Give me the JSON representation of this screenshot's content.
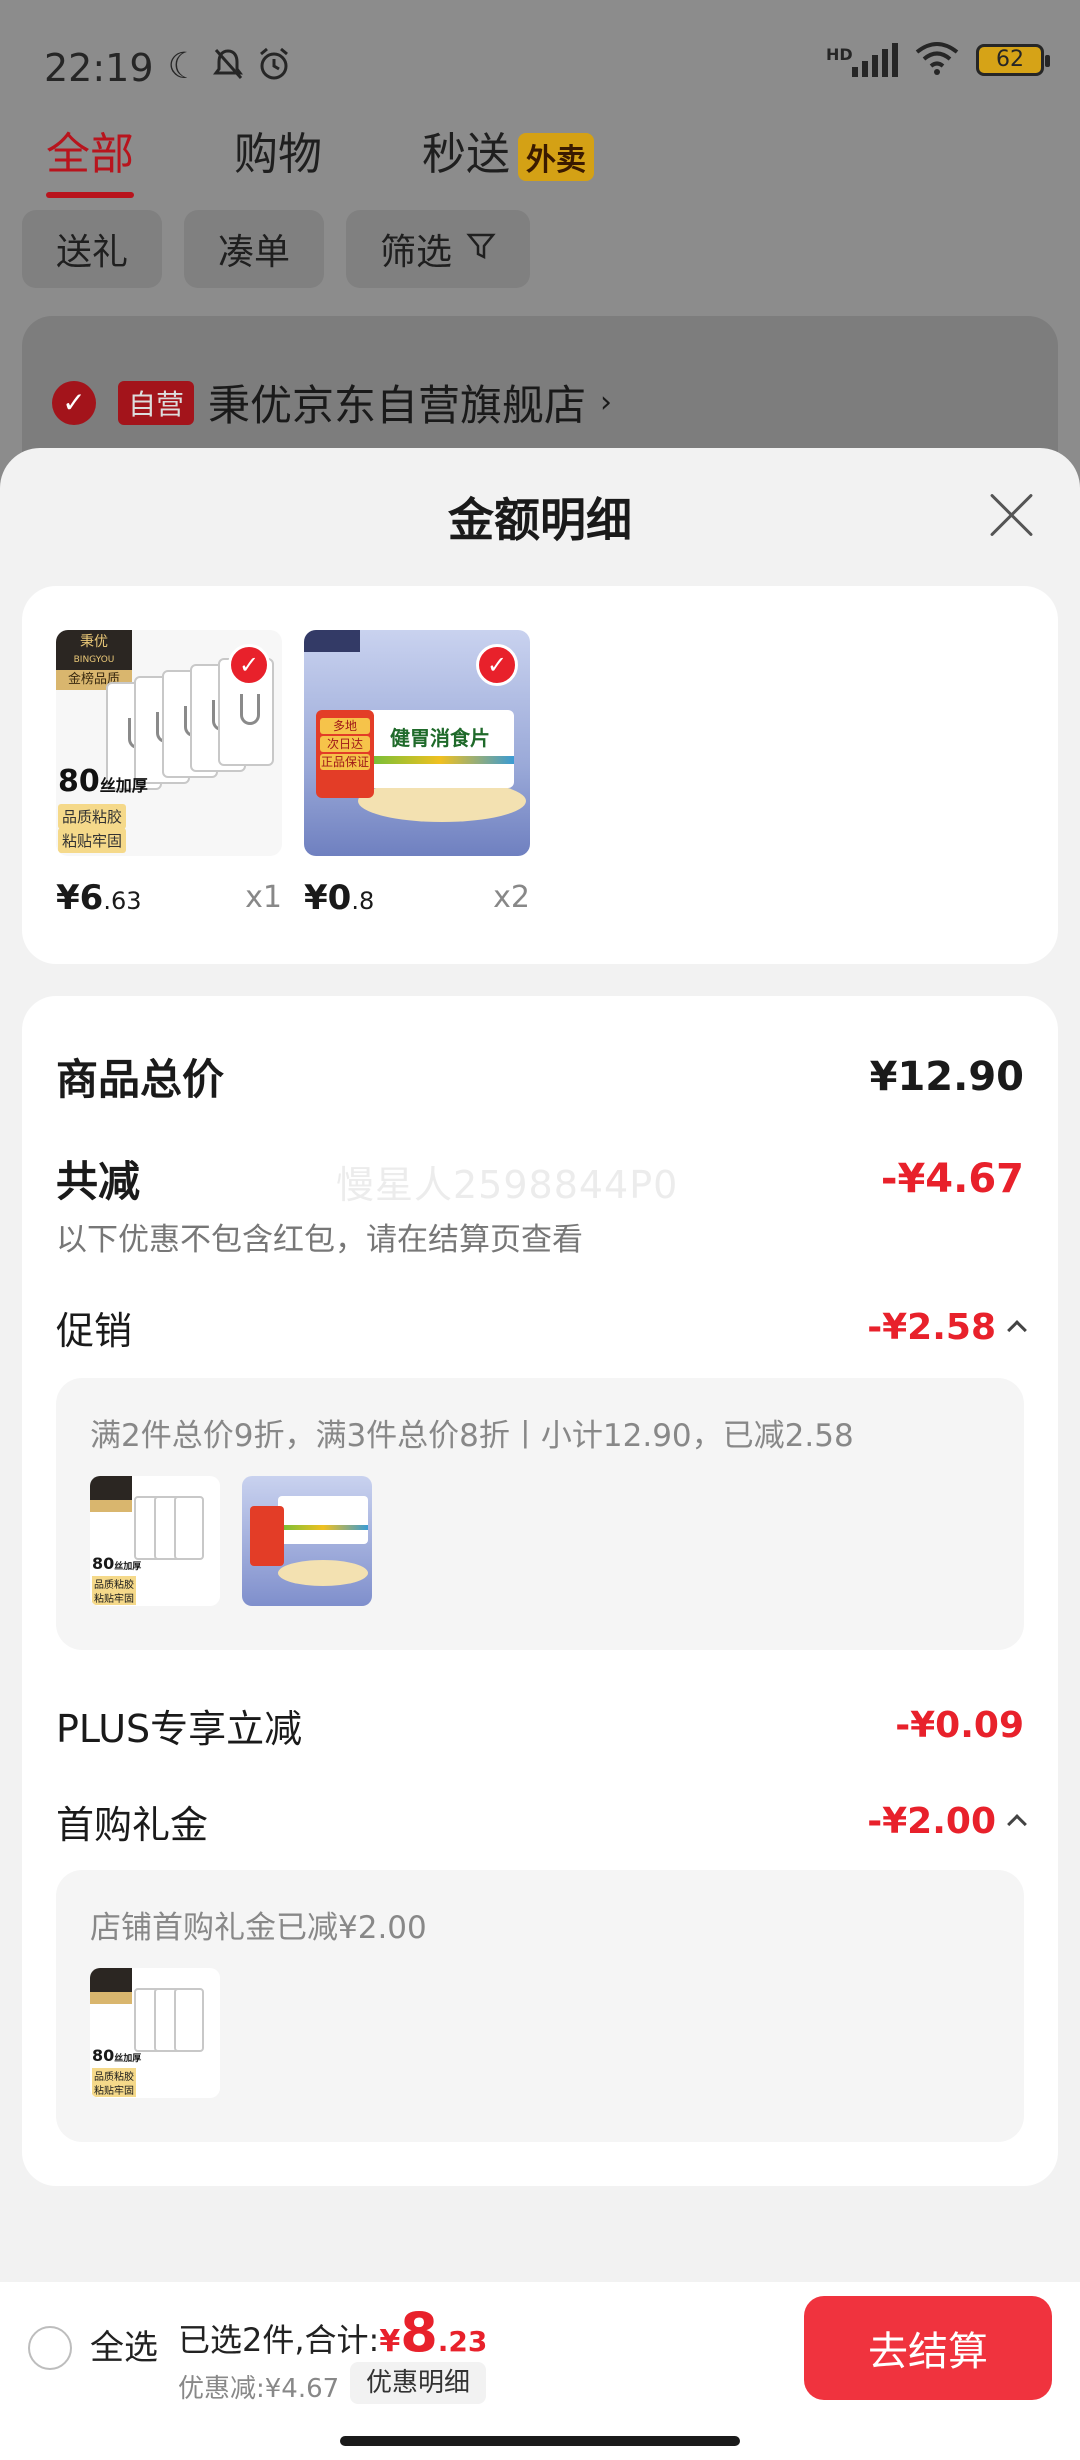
{
  "status_bar": {
    "time": "22:19",
    "network": "HD",
    "battery": "62"
  },
  "tabs": [
    {
      "label": "全部"
    },
    {
      "label": "购物"
    },
    {
      "label": "秒送",
      "badge": "外卖"
    }
  ],
  "filters": [
    "送礼",
    "凑单",
    "筛选"
  ],
  "store": {
    "badge": "自营",
    "name": "秉优京东自营旗舰店"
  },
  "sheet": {
    "title": "金额明细",
    "watermark": "慢星人2598844P0",
    "products": [
      {
        "price_int": "¥6",
        "price_dec": ".63",
        "qty": "x1",
        "image": {
          "brand": "秉优",
          "brand_sub": "BINGYOU",
          "gold": "金榜品质",
          "thickness": "80",
          "thickness_unit": "丝加厚",
          "tag1": "品质粘胶",
          "tag2": "粘贴牢固"
        }
      },
      {
        "price_int": "¥0",
        "price_dec": ".8",
        "qty": "x2",
        "image": {
          "box_name": "健胃消食片",
          "gift1": "多地",
          "gift2": "次日达",
          "gift3": "正品保证"
        }
      }
    ],
    "total_label": "商品总价",
    "total_value": "¥12.90",
    "reduce_label": "共减",
    "reduce_value": "-¥4.67",
    "reduce_note": "以下优惠不包含红包，请在结算页查看",
    "promo_label": "促销",
    "promo_value": "-¥2.58",
    "promo_desc": "满2件总价9折，满3件总价8折丨小计12.90，已减2.58",
    "mini": {
      "thickness": "80",
      "thickness_unit": "丝加厚",
      "tag1": "品质粘胶",
      "tag2": "粘贴牢固"
    },
    "plus_label": "PLUS专享立减",
    "plus_value": "-¥0.09",
    "first_label": "首购礼金",
    "first_value": "-¥2.00",
    "first_desc": "店铺首购礼金已减¥2.00"
  },
  "bottom": {
    "select_all": "全选",
    "summary_prefix": "已选2件,合计:",
    "currency": "¥",
    "amount_int": "8",
    "amount_dec": ".23",
    "discount": "优惠减:¥4.67",
    "detail_button": "优惠明细",
    "checkout_button": "去结算"
  },
  "colors": {
    "accent": "#e8212b",
    "checkout": "#f0333e",
    "sheet_bg": "#f2f2f2",
    "overlay": "#8a8a8a"
  }
}
